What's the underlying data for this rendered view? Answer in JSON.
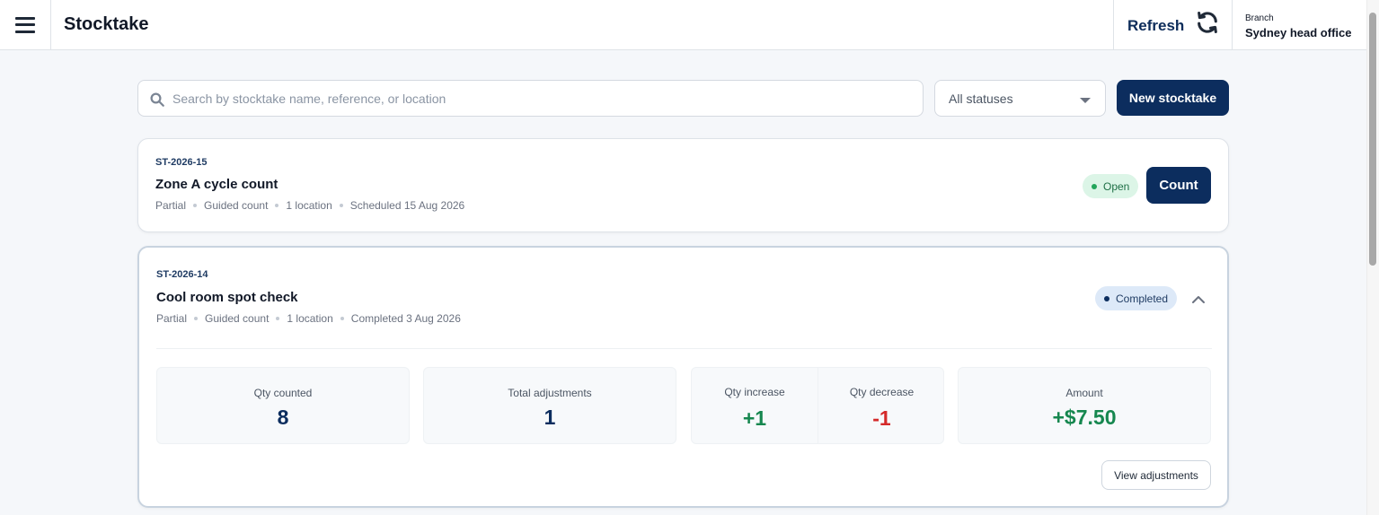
{
  "header": {
    "title": "Stocktake",
    "refresh_label": "Refresh",
    "branch_caption": "Branch",
    "branch_name": "Sydney head office"
  },
  "toolbar": {
    "search_placeholder": "Search by stocktake name, reference, or location",
    "status_filter_value": "All statuses",
    "new_button_label": "New stocktake"
  },
  "stocktakes": [
    {
      "reference": "ST-2026-15",
      "name": "Zone A cycle count",
      "meta": [
        "Partial",
        "Guided count",
        "1 location",
        "Scheduled 15 Aug 2026"
      ],
      "status": "Open",
      "action_label": "Count"
    },
    {
      "reference": "ST-2026-14",
      "name": "Cool room spot check",
      "meta": [
        "Partial",
        "Guided count",
        "1 location",
        "Completed 3 Aug 2026"
      ],
      "status": "Completed",
      "stats": {
        "qty_counted_label": "Qty counted",
        "qty_counted": "8",
        "total_adjustments_label": "Total adjustments",
        "total_adjustments": "1",
        "qty_increase_label": "Qty increase",
        "qty_increase": "+1",
        "qty_decrease_label": "Qty decrease",
        "qty_decrease": "-1",
        "amount_label": "Amount",
        "amount": "+$7.50"
      },
      "view_button_label": "View adjustments"
    }
  ],
  "colors": {
    "primary": "#0c2d5e",
    "open_badge_bg": "#dcf5e7",
    "completed_badge_bg": "#dde9f8",
    "positive": "#16874f",
    "negative": "#d42a2a"
  },
  "icons": {
    "menu": "hamburger-menu-icon",
    "refresh": "refresh-icon",
    "search": "search-icon",
    "dropdown": "caret-down-icon",
    "collapse": "chevron-up-icon"
  }
}
